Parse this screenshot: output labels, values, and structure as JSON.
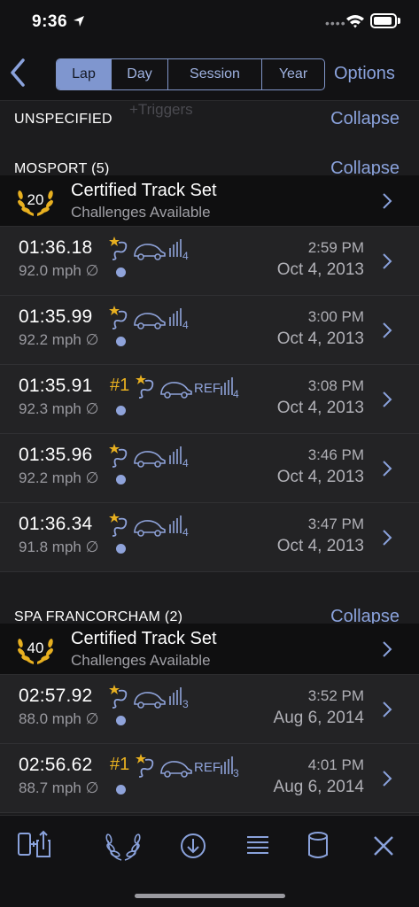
{
  "status": {
    "time": "9:36",
    "dots": "••••"
  },
  "nav": {
    "segments": [
      {
        "label": "Lap",
        "selected": true
      },
      {
        "label": "Day",
        "selected": false
      },
      {
        "label": "Session",
        "selected": false
      },
      {
        "label": "Year",
        "selected": false
      }
    ],
    "options_label": "Options"
  },
  "sections": [
    {
      "title": "UNSPECIFIED",
      "collapse_label": "Collapse",
      "ghost_text": "+Triggers"
    },
    {
      "title": "MOSPORT (5)",
      "collapse_label": "Collapse",
      "certified": {
        "number": "20",
        "title": "Certified Track Set",
        "subtitle": "Challenges Available"
      },
      "laps": [
        {
          "lap_time": "01:36.18",
          "speed": "92.0 mph ∅",
          "rank": "",
          "ref": "",
          "signal": "4",
          "time": "2:59 PM",
          "date": "Oct 4, 2013"
        },
        {
          "lap_time": "01:35.99",
          "speed": "92.2 mph ∅",
          "rank": "",
          "ref": "",
          "signal": "4",
          "time": "3:00 PM",
          "date": "Oct 4, 2013"
        },
        {
          "lap_time": "01:35.91",
          "speed": "92.3 mph ∅",
          "rank": "#1",
          "ref": "REF",
          "signal": "4",
          "time": "3:08 PM",
          "date": "Oct 4, 2013"
        },
        {
          "lap_time": "01:35.96",
          "speed": "92.2 mph ∅",
          "rank": "",
          "ref": "",
          "signal": "4",
          "time": "3:46 PM",
          "date": "Oct 4, 2013"
        },
        {
          "lap_time": "01:36.34",
          "speed": "91.8 mph ∅",
          "rank": "",
          "ref": "",
          "signal": "4",
          "time": "3:47 PM",
          "date": "Oct 4, 2013"
        }
      ]
    },
    {
      "title": "SPA FRANCORCHAM (2)",
      "collapse_label": "Collapse",
      "certified": {
        "number": "40",
        "title": "Certified Track Set",
        "subtitle": "Challenges Available"
      },
      "laps": [
        {
          "lap_time": "02:57.92",
          "speed": "88.0 mph ∅",
          "rank": "",
          "ref": "",
          "signal": "3",
          "time": "3:52 PM",
          "date": "Aug 6, 2014"
        },
        {
          "lap_time": "02:56.62",
          "speed": "88.7 mph ∅",
          "rank": "#1",
          "ref": "REF",
          "signal": "3",
          "time": "4:01 PM",
          "date": "Aug 6, 2014"
        }
      ]
    }
  ],
  "toolbar": {
    "icons": [
      "device-share-icon",
      "laurel-icon",
      "download-icon",
      "list-icon",
      "database-icon",
      "close-icon"
    ]
  },
  "colors": {
    "accent": "#8aa2dc",
    "gold": "#e8b020",
    "background": "#1c1c1e",
    "bar": "#121214"
  }
}
